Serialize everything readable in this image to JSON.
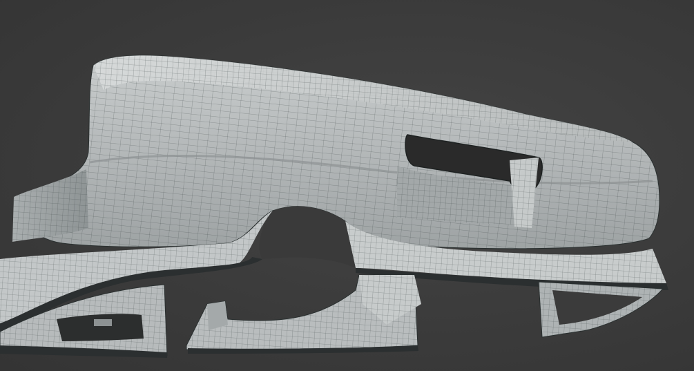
{
  "viewport": {
    "background_color": "#3a3a3a",
    "mesh_fill_color": "#b9bdbe",
    "mesh_shade_color": "#8f9496",
    "wire_color": "#2f3838",
    "cavity_color": "#2a2a2a"
  },
  "objects": [
    {
      "id": "rear-bumper",
      "mesh": "rear-bumper-mesh"
    },
    {
      "id": "front-bumper",
      "mesh": "front-lip-mesh"
    },
    {
      "id": "side-skirt",
      "mesh": "side-skirt-mesh"
    },
    {
      "id": "rear-diffuser-fin",
      "mesh": "diffuser-fin-mesh"
    }
  ]
}
